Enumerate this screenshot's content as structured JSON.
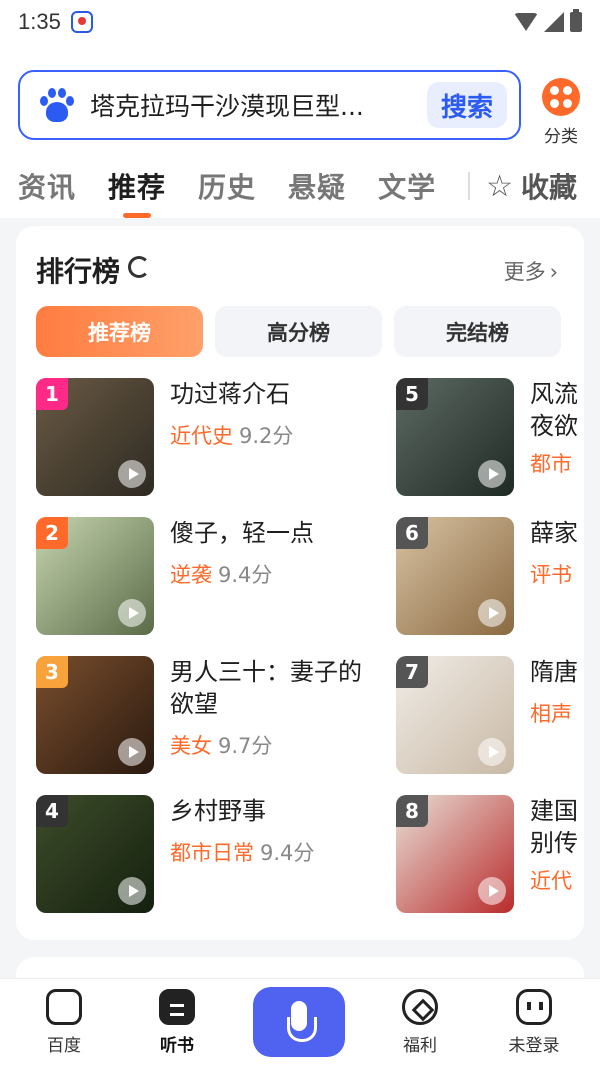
{
  "status_bar": {
    "time": "1:35"
  },
  "search": {
    "query": "塔克拉玛干沙漠现巨型...",
    "button": "搜索"
  },
  "category": {
    "label": "分类",
    "accent": "#ff6a2a"
  },
  "tabs": [
    {
      "label": "资讯"
    },
    {
      "label": "推荐"
    },
    {
      "label": "历史"
    },
    {
      "label": "悬疑"
    },
    {
      "label": "文学"
    }
  ],
  "favorites": {
    "label": "收藏"
  },
  "ranking": {
    "title": "排行榜",
    "more": "更多",
    "pills": [
      {
        "label": "推荐榜"
      },
      {
        "label": "高分榜"
      },
      {
        "label": "完结榜"
      }
    ],
    "books": [
      {
        "rank": "1",
        "title": "功过蒋介石",
        "genre": "近代史",
        "score": "9.2分",
        "rank_color": "#ff2a88",
        "cover_bg": "linear-gradient(135deg,#6a5a44,#2e2a22)"
      },
      {
        "rank": "2",
        "title": "傻子，轻一点",
        "genre": "逆袭",
        "score": "9.4分",
        "rank_color": "#ff6a2a",
        "cover_bg": "linear-gradient(135deg,#c7d6b0,#5a6b48)"
      },
      {
        "rank": "3",
        "title": "男人三十：妻子的欲望",
        "genre": "美女",
        "score": "9.7分",
        "rank_color": "#f7a23b",
        "cover_bg": "linear-gradient(135deg,#7a4e2c,#2a1a10)"
      },
      {
        "rank": "4",
        "title": "乡村野事",
        "genre": "都市日常",
        "score": "9.4分",
        "rank_color": "#333333",
        "cover_bg": "linear-gradient(135deg,#3e4d2a,#14200f)"
      },
      {
        "rank": "5",
        "title": "风流",
        "title2": "夜欲",
        "genre": "都市",
        "rank_color": "#333333",
        "cover_bg": "linear-gradient(135deg,#5d6a63,#1f2a24)"
      },
      {
        "rank": "6",
        "title": "薛家",
        "genre": "评书",
        "rank_color": "#555555",
        "cover_bg": "linear-gradient(135deg,#d8c2a3,#8a6a42)"
      },
      {
        "rank": "7",
        "title": "隋唐",
        "genre": "相声",
        "rank_color": "#555555",
        "cover_bg": "linear-gradient(135deg,#f0ece6,#c9b9a6)"
      },
      {
        "rank": "8",
        "title": "建国",
        "title2": "别传",
        "genre": "近代",
        "rank_color": "#555555",
        "cover_bg": "linear-gradient(135deg,#e8e1d8,#b92b2b)"
      }
    ]
  },
  "bottom_nav": [
    {
      "label": "百度"
    },
    {
      "label": "听书"
    },
    {
      "label": "福利"
    },
    {
      "label": "未登录"
    }
  ],
  "colors": {
    "accent": "#ff6a2a",
    "primary": "#3a61ff",
    "mic": "#4f62f0"
  }
}
